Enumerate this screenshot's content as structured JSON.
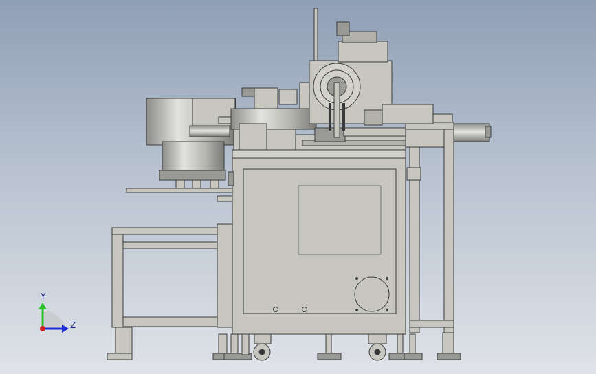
{
  "viewport": {
    "background_top": "#8f9fb6",
    "background_bottom": "#dfe3e8"
  },
  "triad": {
    "y_label": "Y",
    "z_label": "Z",
    "y_color": "#2ec02e",
    "z_color": "#2030d8",
    "origin_color": "#d02020"
  },
  "model": {
    "name": "",
    "body_color": "#c7c6bf",
    "line_color": "#3a3a3a",
    "metal_color": "#9a9a96"
  }
}
